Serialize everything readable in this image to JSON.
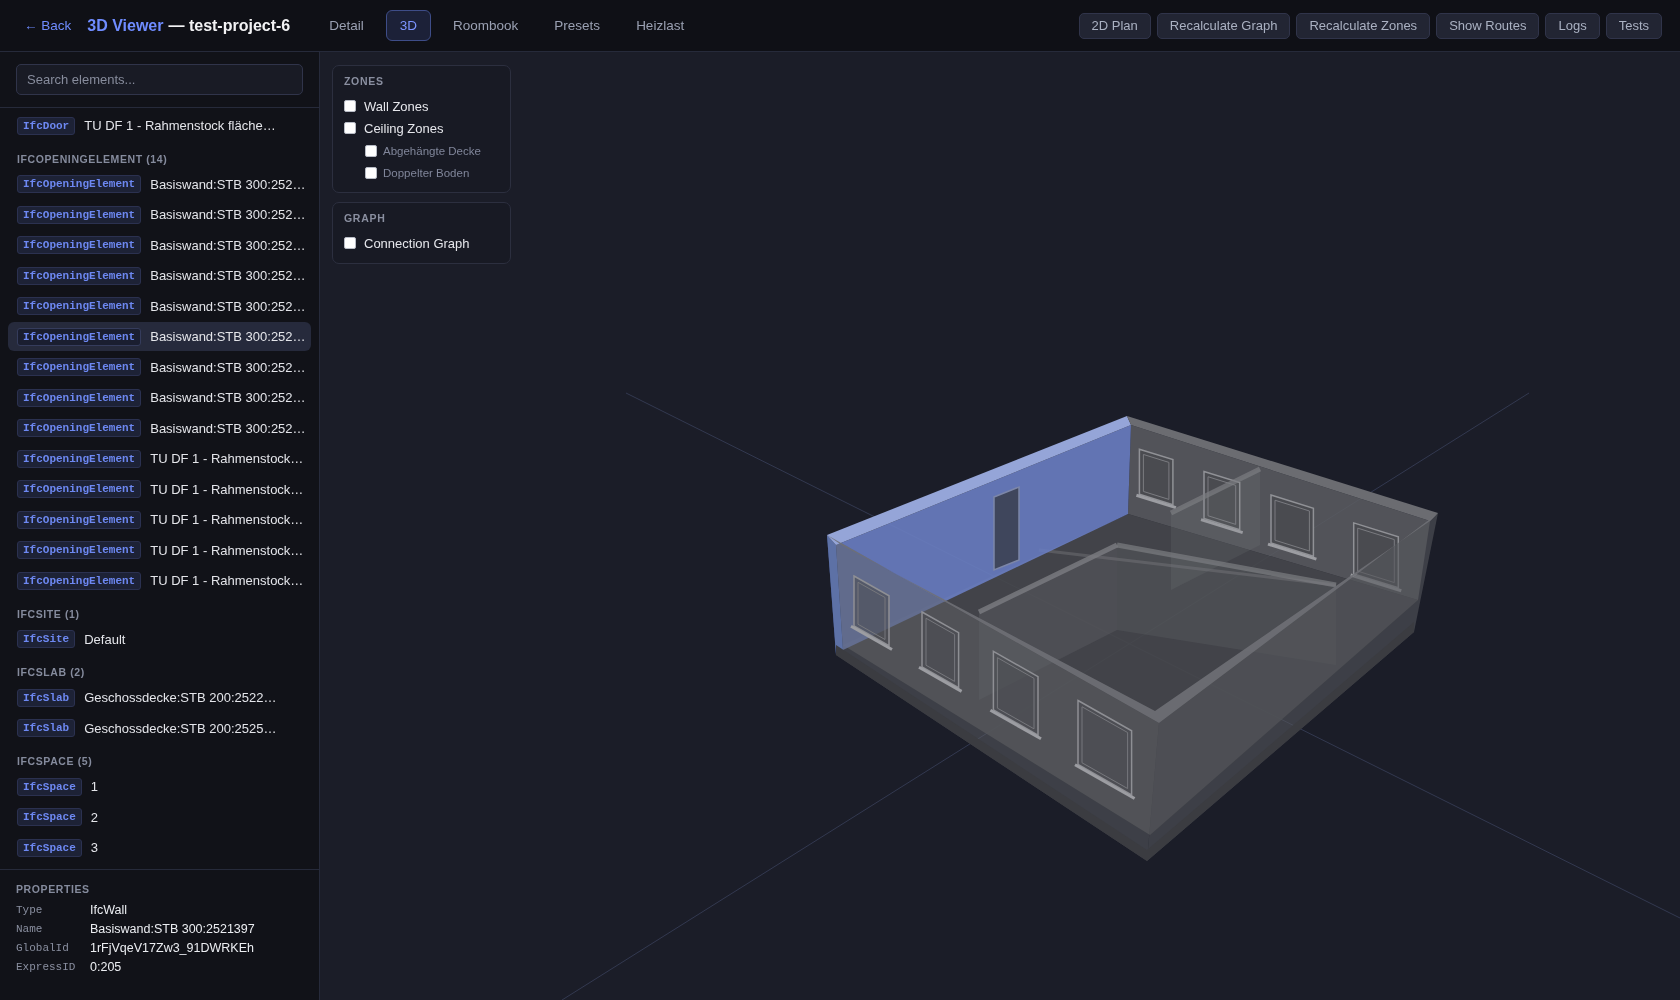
{
  "header": {
    "back": "← Back",
    "title": "3D Viewer",
    "project": "— test-project-6",
    "tabs": [
      {
        "label": "Detail",
        "selected": false
      },
      {
        "label": "3D",
        "selected": true
      },
      {
        "label": "Roombook",
        "selected": false
      },
      {
        "label": "Presets",
        "selected": false
      },
      {
        "label": "Heizlast",
        "selected": false
      }
    ],
    "actions": [
      "2D Plan",
      "Recalculate Graph",
      "Recalculate Zones",
      "Show Routes",
      "Logs",
      "Tests"
    ]
  },
  "sidebar": {
    "search": {
      "placeholder": "Search elements..."
    },
    "groups": [
      {
        "items": [
          {
            "type": "IfcDoor",
            "name": "TU DF 1 - Rahmenstock fläche…",
            "selected": false
          }
        ]
      },
      {
        "heading": "IFCOPENINGELEMENT (14)",
        "items": [
          {
            "type": "IfcOpeningElement",
            "name": "Basiswand:STB 300:252…",
            "selected": false
          },
          {
            "type": "IfcOpeningElement",
            "name": "Basiswand:STB 300:252…",
            "selected": false
          },
          {
            "type": "IfcOpeningElement",
            "name": "Basiswand:STB 300:252…",
            "selected": false
          },
          {
            "type": "IfcOpeningElement",
            "name": "Basiswand:STB 300:252…",
            "selected": false
          },
          {
            "type": "IfcOpeningElement",
            "name": "Basiswand:STB 300:252…",
            "selected": false
          },
          {
            "type": "IfcOpeningElement",
            "name": "Basiswand:STB 300:252…",
            "selected": true
          },
          {
            "type": "IfcOpeningElement",
            "name": "Basiswand:STB 300:252…",
            "selected": false
          },
          {
            "type": "IfcOpeningElement",
            "name": "Basiswand:STB 300:252…",
            "selected": false
          },
          {
            "type": "IfcOpeningElement",
            "name": "Basiswand:STB 300:252…",
            "selected": false
          },
          {
            "type": "IfcOpeningElement",
            "name": "TU DF 1 - Rahmenstock…",
            "selected": false
          },
          {
            "type": "IfcOpeningElement",
            "name": "TU DF 1 - Rahmenstock…",
            "selected": false
          },
          {
            "type": "IfcOpeningElement",
            "name": "TU DF 1 - Rahmenstock…",
            "selected": false
          },
          {
            "type": "IfcOpeningElement",
            "name": "TU DF 1 - Rahmenstock…",
            "selected": false
          },
          {
            "type": "IfcOpeningElement",
            "name": "TU DF 1 - Rahmenstock…",
            "selected": false
          }
        ]
      },
      {
        "heading": "IFCSITE (1)",
        "items": [
          {
            "type": "IfcSite",
            "name": "Default",
            "selected": false
          }
        ]
      },
      {
        "heading": "IFCSLAB (2)",
        "items": [
          {
            "type": "IfcSlab",
            "name": "Geschossdecke:STB 200:2522…",
            "selected": false
          },
          {
            "type": "IfcSlab",
            "name": "Geschossdecke:STB 200:2525…",
            "selected": false
          }
        ]
      },
      {
        "heading": "IFCSPACE (5)",
        "items": [
          {
            "type": "IfcSpace",
            "name": "1",
            "selected": false
          },
          {
            "type": "IfcSpace",
            "name": "2",
            "selected": false
          },
          {
            "type": "IfcSpace",
            "name": "3",
            "selected": false
          }
        ]
      }
    ]
  },
  "properties": {
    "title": "PROPERTIES",
    "rows": [
      {
        "key": "Type",
        "value": "IfcWall"
      },
      {
        "key": "Name",
        "value": "Basiswand:STB 300:2521397"
      },
      {
        "key": "GlobalId",
        "value": "1rFjVqeV17Zw3_91DWRKEh"
      },
      {
        "key": "ExpressID",
        "value": "0:205"
      }
    ]
  },
  "viewport": {
    "layer_panels": [
      {
        "title": "ZONES",
        "options": [
          {
            "label": "Wall Zones",
            "checked": false
          },
          {
            "label": "Ceiling Zones",
            "checked": false,
            "children": [
              {
                "label": "Abgehängte Decke",
                "checked": false,
                "disabled": true
              },
              {
                "label": "Doppelter Boden",
                "checked": false,
                "disabled": true
              }
            ]
          }
        ]
      },
      {
        "title": "GRAPH",
        "options": [
          {
            "label": "Connection Graph",
            "checked": false
          }
        ]
      }
    ]
  }
}
